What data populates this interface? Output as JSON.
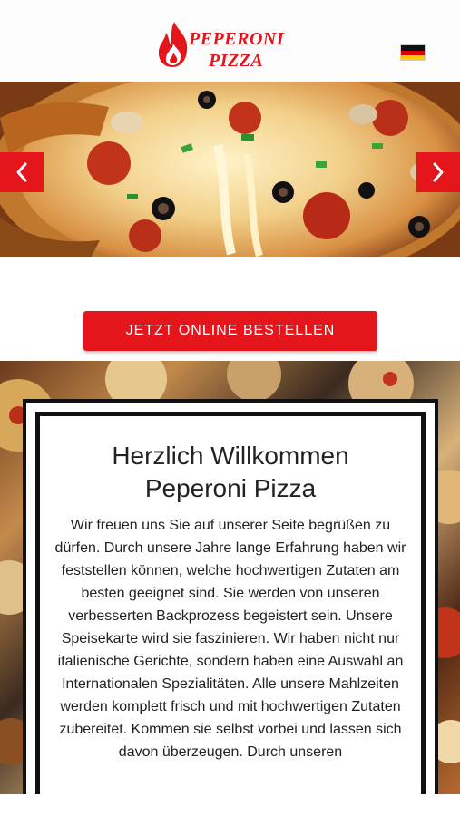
{
  "header": {
    "brand_line1": "PEPERONI",
    "brand_line2": "PIZZA",
    "logo_icon": "flame-icon",
    "language_flag": "german-flag-icon"
  },
  "slider": {
    "prev_icon": "chevron-left-icon",
    "next_icon": "chevron-right-icon"
  },
  "order": {
    "button_label": "JETZT ONLINE BESTELLEN"
  },
  "welcome": {
    "title_line1": "Herzlich Willkommen",
    "title_line2": "Peperoni Pizza",
    "body": "Wir freuen uns Sie auf unserer Seite begrüßen zu dürfen. Durch unsere Jahre lange Erfahrung haben wir feststellen können, welche hochwertigen Zutaten am besten geeignet sind. Sie werden von unseren verbesserten Backprozess begeistert sein. Unsere Speisekarte wird sie faszinieren. Wir haben nicht nur italienische Gerichte, sondern haben eine Auswahl an Internationalen Spezialitäten. Alle unsere Mahlzeiten werden komplett frisch und mit hochwertigen Zutaten zubereitet. Kommen sie selbst vorbei und lassen sich davon überzeugen. Durch unseren"
  },
  "colors": {
    "accent": "#e4161b",
    "frame": "#111111"
  }
}
